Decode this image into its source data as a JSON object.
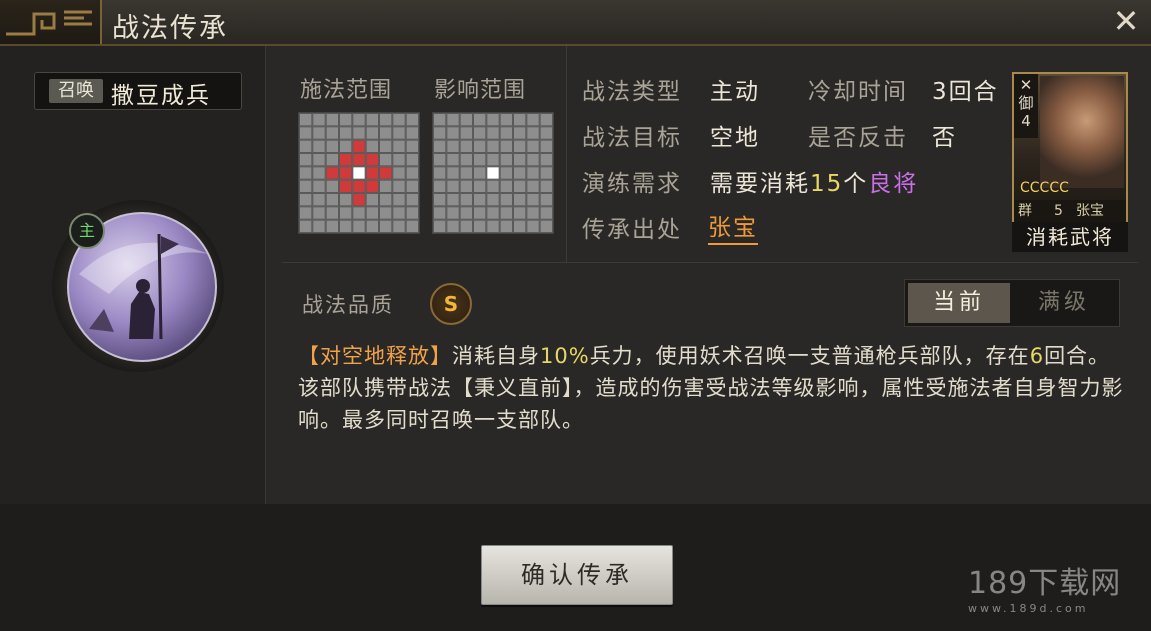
{
  "title": "战法传承",
  "skill": {
    "tag": "召唤",
    "name": "撒豆成兵",
    "badge": "主"
  },
  "range": {
    "cast_label": "施法范围",
    "effect_label": "影响范围"
  },
  "info": {
    "type_label": "战法类型",
    "type_value": "主动",
    "cooldown_label": "冷却时间",
    "cooldown_value": "3回合",
    "target_label": "战法目标",
    "target_value": "空地",
    "counter_label": "是否反击",
    "counter_value": "否",
    "require_label": "演练需求",
    "require_prefix": "需要消耗",
    "require_count": "15",
    "require_unit": "个",
    "require_quality": "良将",
    "source_label": "传承出处",
    "source_value": "张宝"
  },
  "general_card": {
    "side_top": "群",
    "side_type": "御",
    "side_level": "4",
    "stars": "CCCCC",
    "faction": "群",
    "cost": "5",
    "name": "张宝",
    "caption": "消耗武将"
  },
  "quality": {
    "label": "战法品质",
    "grade": "S"
  },
  "toggle": {
    "current": "当前",
    "max": "满级"
  },
  "description": {
    "bracket": "【对空地释放】",
    "p1": "消耗自身",
    "pct": "10%",
    "p2": "兵力，使用妖术召唤一支普通枪兵部队，存在",
    "rounds": "6",
    "p3": "回合。该部队携带战法【秉义直前】，造成的伤害受战法等级影响，属性受施法者自身智力影响。最多同时召唤一支部队。"
  },
  "confirm_button": "确认传承",
  "watermark": {
    "big": "189下载网",
    "small": "www.189d.com"
  },
  "colors": {
    "range_fill": "#d03a3a",
    "center": "#ffffff",
    "accent_link": "#ee9a3a",
    "number": "#e8d766",
    "good_quality": "#c86fe6"
  }
}
